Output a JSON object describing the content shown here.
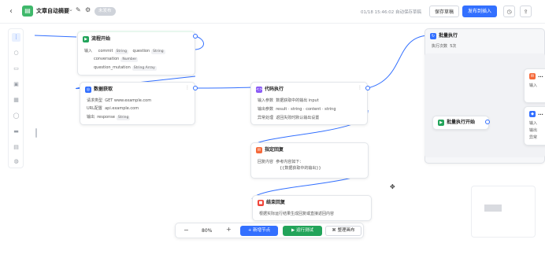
{
  "topbar": {
    "back_icon": "chevron-left-icon",
    "title": "文章自动摘要",
    "badge": "未发布",
    "status": "01/18 15:46:02 自动保存草稿",
    "save_label": "保存草稿",
    "publish_label": "发布到插入"
  },
  "nodes": {
    "start": {
      "title": "流程开始",
      "input_label": "输入",
      "vars": [
        "commit",
        "question",
        "conversation",
        "question_mutation"
      ],
      "tags": [
        "String",
        "String",
        "Number",
        "String Array"
      ]
    },
    "http": {
      "title": "数据获取",
      "rows": [
        {
          "label": "请求类型",
          "value": "GET www.example.com"
        },
        {
          "label": "URL配置",
          "value": "api.example.com"
        },
        {
          "label": "输出",
          "value": "response",
          "tag": "String"
        }
      ]
    },
    "code": {
      "title": "代码执行",
      "rows": [
        {
          "label": "输入参数",
          "value": "数据获取中的输出 input"
        },
        {
          "label": "输出参数",
          "value": "result · string · content · string"
        },
        {
          "label": "异常处理",
          "value": "返回失败时默认输出设置"
        }
      ]
    },
    "reply": {
      "title": "指定回复",
      "rows": [
        {
          "label": "回复内容",
          "value": "参考内容如下："
        },
        {
          "label": "",
          "value": "{{数据获取中的输出}}"
        }
      ]
    },
    "end": {
      "title": "结束回复",
      "text": "根据实际运行结果生成回复或直接返回内容"
    },
    "batch": {
      "title": "批量执行",
      "row_label": "执行次数",
      "row_value": "5次"
    },
    "batch_start": {
      "title": "批量执行开始"
    },
    "batch_item_1": {
      "title": "...",
      "text": "输入"
    },
    "batch_item_2": {
      "title": "...",
      "rows": [
        "输入",
        "输出",
        "异常"
      ]
    }
  },
  "toolbar": {
    "zoom": "80%",
    "add_node_label": "+ 新增节点",
    "run_label": "运行测试",
    "clean_label": "整理画布"
  },
  "colors": {
    "accent": "#3370ff",
    "success": "#22a45a",
    "warning": "#f56a3b",
    "purple": "#8b5cf6"
  }
}
